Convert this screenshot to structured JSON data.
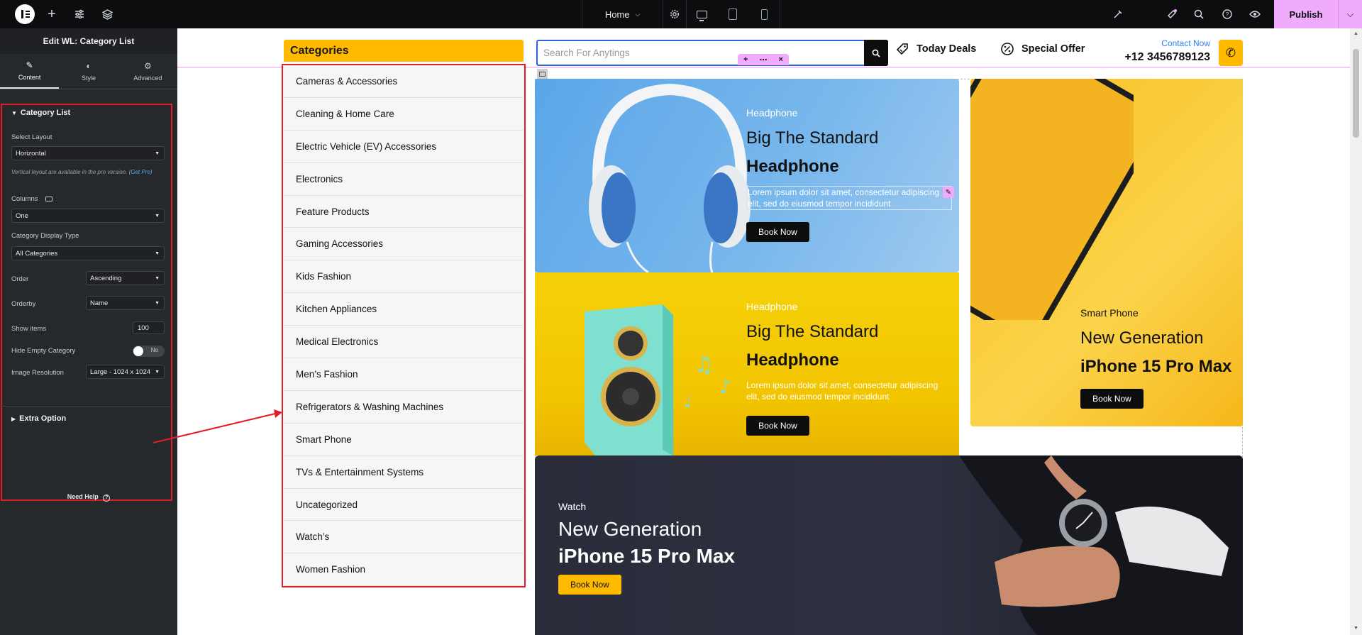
{
  "topbar": {
    "page_name": "Home",
    "publish_label": "Publish"
  },
  "panel": {
    "title": "Edit WL: Category List",
    "tabs": [
      {
        "label": "Content",
        "icon": "pencil-icon"
      },
      {
        "label": "Style",
        "icon": "half-circle-icon"
      },
      {
        "label": "Advanced",
        "icon": "gear-icon"
      }
    ],
    "section_title": "Category List",
    "select_layout_label": "Select Layout",
    "select_layout_value": "Horizontal",
    "note_text": "Vertical layout are available in the pro version. (",
    "note_link": "Get Pro",
    "note_end": ")",
    "columns_label": "Columns",
    "columns_value": "One",
    "display_type_label": "Category Display Type",
    "display_type_value": "All Categories",
    "order_label": "Order",
    "order_value": "Ascending",
    "orderby_label": "Orderby",
    "orderby_value": "Name",
    "show_items_label": "Show items",
    "show_items_value": "100",
    "hide_empty_label": "Hide Empty Category",
    "hide_empty_value": "No",
    "image_res_label": "Image Resolution",
    "image_res_value": "Large - 1024 x 1024",
    "extra_option_label": "Extra Option",
    "need_help_label": "Need Help"
  },
  "site": {
    "categories_title": "Categories",
    "categories": [
      "Cameras & Accessories",
      "Cleaning & Home Care",
      "Electric Vehicle (EV) Accessories",
      "Electronics",
      "Feature Products",
      "Gaming Accessories",
      "Kids Fashion",
      "Kitchen Appliances",
      "Medical Electronics",
      "Men’s Fashion",
      "Refrigerators & Washing Machines",
      "Smart Phone",
      "TVs & Entertainment Systems",
      "Uncategorized",
      "Watch’s",
      "Women Fashion"
    ],
    "search_placeholder": "Search For Anytings",
    "today_deals": "Today Deals",
    "special_offer": "Special Offer",
    "contact_label": "Contact Now",
    "contact_phone": "+12 3456789123",
    "banner1": {
      "tag": "Headphone",
      "title1": "Big The Standard",
      "title2": "Headphone",
      "desc": "Lorem ipsum dolor sit amet, consectetur adipiscing elit, sed do eiusmod tempor incididunt",
      "button": "Book Now"
    },
    "banner2": {
      "tag": "Headphone",
      "title1": "Big The Standard",
      "title2": "Headphone",
      "desc": "Lorem ipsum dolor sit amet, consectetur adipiscing elit, sed do eiusmod tempor incididunt",
      "button": "Book Now"
    },
    "banner3": {
      "tag": "Smart Phone",
      "title1": "New Generation",
      "title2": "iPhone 15 Pro Max",
      "button": "Book Now"
    },
    "banner4": {
      "tag": "Watch",
      "title1": "New Generation",
      "title2": "iPhone 15 Pro Max",
      "button": "Book Now"
    }
  },
  "colors": {
    "accent_yellow": "#ffba00",
    "editor_pink": "#f0abfc",
    "highlight_red": "#e11d2a",
    "link_blue": "#2d7ff9"
  }
}
